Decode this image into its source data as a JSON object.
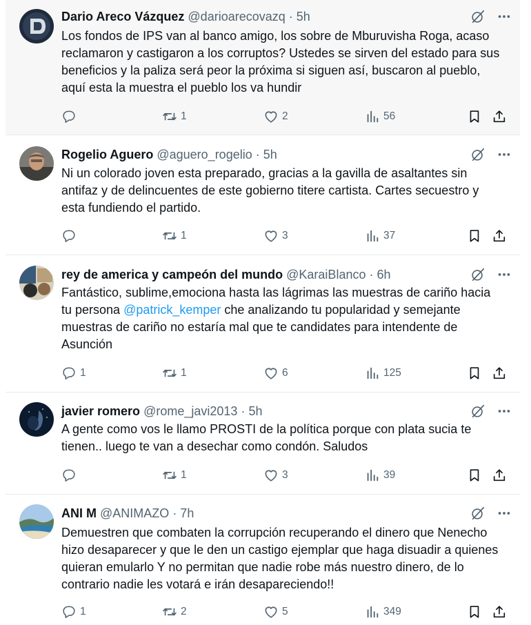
{
  "tweets": [
    {
      "name": "Dario Areco Vázquez",
      "handle": "@darioarecovazq",
      "time": "· 5h",
      "text": "Los fondos de IPS van al banco amigo, los sobre de Mburuvisha Roga, acaso reclamaron y castigaron a los corruptos? Ustedes se sirven del estado para sus beneficios y la paliza será peor la próxima si siguen así, buscaron al pueblo, aquí esta la muestra el pueblo los va hundir",
      "replies": "",
      "retweets": "1",
      "likes": "2",
      "views": "56"
    },
    {
      "name": "Rogelio Aguero",
      "handle": "@aguero_rogelio",
      "time": "· 5h",
      "text": "Ni un colorado joven esta preparado, gracias a la gavilla de asaltantes sin antifaz y de delincuentes de este gobierno titere cartista. Cartes secuestro y esta fundiendo el partido.",
      "replies": "",
      "retweets": "1",
      "likes": "3",
      "views": "37"
    },
    {
      "name": "rey de america y campeón del mundo",
      "handle": "@KaraiBlanco",
      "time": "· 6h",
      "text_before": "Fantástico, sublime,emociona hasta las lágrimas las muestras de cariño hacia tu persona ",
      "mention": "@patrick_kemper",
      "text_after": " che analizando tu popularidad y semejante muestras de cariño no estaría mal que te candidates para intendente de Asunción",
      "replies": "1",
      "retweets": "1",
      "likes": "6",
      "views": "125"
    },
    {
      "name": "javier romero",
      "handle": "@rome_javi2013",
      "time": "· 5h",
      "text": "A gente como vos le llamo PROSTI de la política porque con plata sucia te tienen.. luego te van a desechar como condón. Saludos",
      "replies": "",
      "retweets": "1",
      "likes": "3",
      "views": "39"
    },
    {
      "name": "ANI M",
      "handle": "@ANIMAZO",
      "time": "· 7h",
      "text": "Demuestren que combaten la corrupción recuperando el dinero que Nenecho hizo desaparecer y que le den un castigo ejemplar que haga disuadir a quienes quieran emularlo Y no permitan que nadie robe más nuestro dinero, de lo contrario nadie les votará e irán desapareciendo!!",
      "replies": "1",
      "retweets": "2",
      "likes": "5",
      "views": "349"
    }
  ],
  "colors": {
    "text": "#0f1419",
    "secondary": "#536471",
    "link": "#1d9bf0",
    "divider": "#e7e9ea",
    "highlight_bg": "#f7f7f7"
  },
  "icons": [
    "grok-icon",
    "more-icon",
    "reply-icon",
    "retweet-icon",
    "like-icon",
    "views-icon",
    "bookmark-icon",
    "share-icon"
  ]
}
